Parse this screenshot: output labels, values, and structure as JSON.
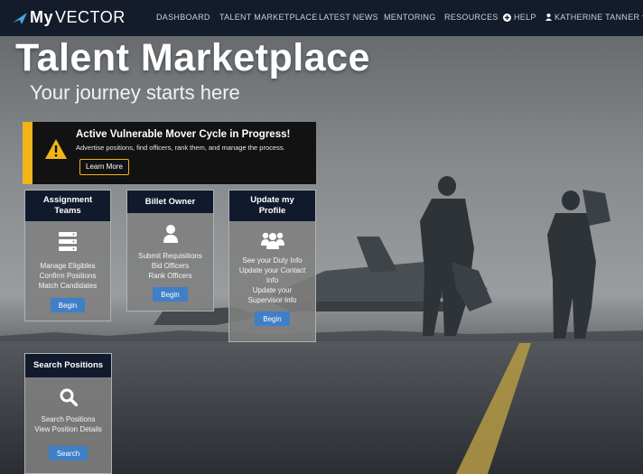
{
  "nav": {
    "brand_prefix": "My",
    "brand_suffix": "VECTOR",
    "links": [
      "DASHBOARD",
      "TALENT MARKETPLACE",
      "LATEST NEWS",
      "MENTORING",
      "RESOURCES"
    ],
    "help": "HELP",
    "user": "KATHERINE TANNER",
    "icons": {
      "logo": "jet-arrow-icon",
      "help": "plus-circle-icon",
      "user": "user-icon",
      "caret": "caret-down-icon"
    }
  },
  "hero": {
    "title": "Talent Marketplace",
    "subtitle": "Your journey starts here"
  },
  "alert": {
    "title": "Active Vulnerable Mover Cycle in Progress!",
    "description": "Advertise positions, find officers, rank them, and manage the process.",
    "button": "Learn More",
    "icon": "warning-triangle-icon",
    "accent": "#f2b418"
  },
  "cards": {
    "assignment": {
      "title_line1": "Assignment",
      "title_line2": "Teams",
      "icon": "server-list-icon",
      "lines": [
        "Manage Eligibles",
        "Confirm Positions",
        "Match Candidates"
      ],
      "button": "Begin"
    },
    "billet": {
      "title": "Billet Owner",
      "icon": "person-icon",
      "lines": [
        "Submit Requisitions",
        "Bid Officers",
        "Rank Officers"
      ],
      "button": "Begin"
    },
    "profile": {
      "title_line1": "Update my",
      "title_line2": "Profile",
      "icon": "group-icon",
      "lines": [
        "See your Duty Info",
        "Update your Contact",
        "Info",
        "Update your",
        "Supervisor Info"
      ],
      "button": "Begin"
    },
    "search": {
      "title": "Search Positions",
      "icon": "search-icon",
      "lines": [
        "Search Positions",
        "View Position Details"
      ],
      "button": "Search"
    }
  },
  "colors": {
    "navbar": "#141c2c",
    "card_header": "#111a2d",
    "button": "#3f7fc7"
  }
}
